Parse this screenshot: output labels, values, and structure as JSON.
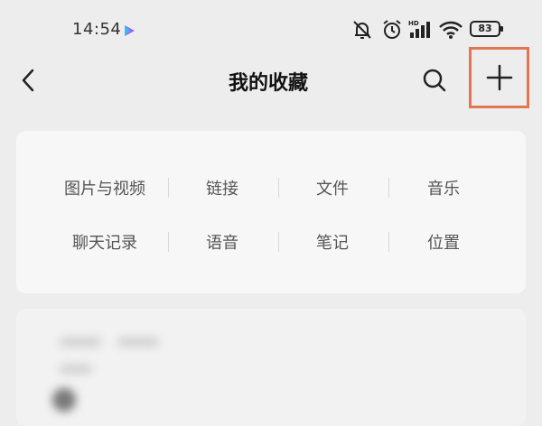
{
  "status_bar": {
    "time": "14:54",
    "battery": "83"
  },
  "header": {
    "title": "我的收藏"
  },
  "categories": [
    {
      "label": "图片与视频"
    },
    {
      "label": "链接"
    },
    {
      "label": "文件"
    },
    {
      "label": "音乐"
    },
    {
      "label": "聊天记录"
    },
    {
      "label": "语音"
    },
    {
      "label": "笔记"
    },
    {
      "label": "位置"
    }
  ],
  "colors": {
    "highlight": "#e2764f",
    "background": "#ededed",
    "card": "#f7f7f8"
  },
  "icons": [
    "play-icon",
    "mute-bell-icon",
    "alarm-icon",
    "signal-icon",
    "wifi-icon",
    "battery-icon",
    "back-icon",
    "search-icon",
    "add-icon"
  ]
}
